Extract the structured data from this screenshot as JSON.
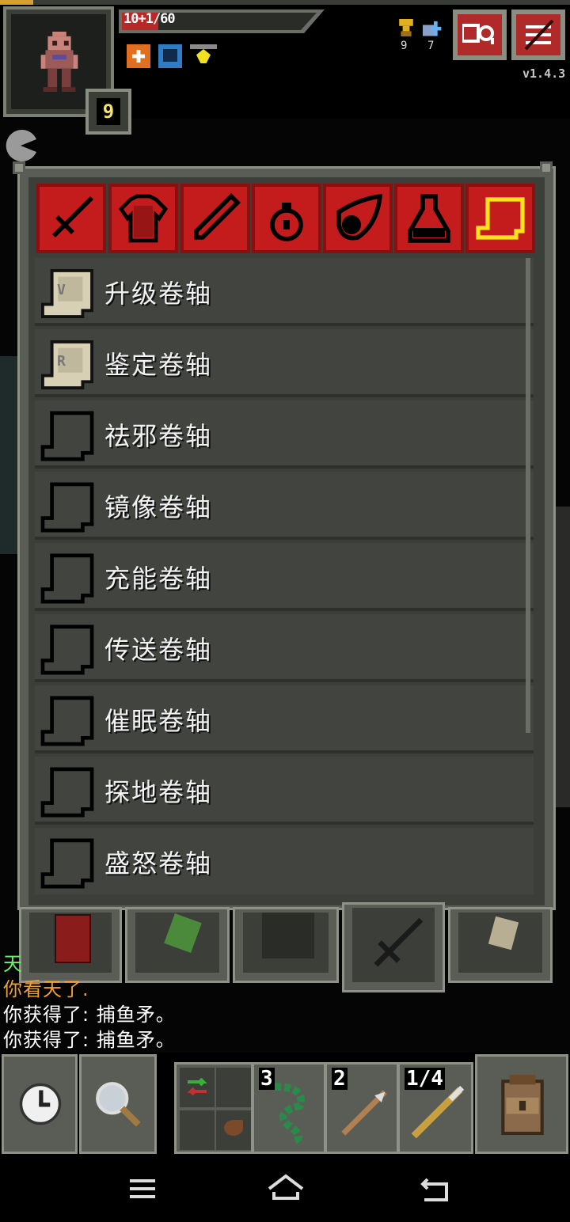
{
  "hud": {
    "hp_text": "10+1/60",
    "level": "9",
    "depth": "9",
    "keys": "7",
    "version": "v1.4.3",
    "buffs": [
      "mind-vision-icon",
      "shielded-icon",
      "light-icon"
    ]
  },
  "categories": [
    {
      "name": "weapon",
      "icon": "sword-icon"
    },
    {
      "name": "armor",
      "icon": "armor-icon"
    },
    {
      "name": "wand",
      "icon": "wand-icon"
    },
    {
      "name": "ring",
      "icon": "ring-icon"
    },
    {
      "name": "artifact",
      "icon": "artifact-icon"
    },
    {
      "name": "potion",
      "icon": "potion-icon"
    },
    {
      "name": "scroll",
      "icon": "scroll-icon",
      "active": true
    }
  ],
  "scrolls": [
    {
      "label": "升级卷轴",
      "known": true,
      "rune": "V"
    },
    {
      "label": "鉴定卷轴",
      "known": true,
      "rune": "R"
    },
    {
      "label": "祛邪卷轴",
      "known": false
    },
    {
      "label": "镜像卷轴",
      "known": false
    },
    {
      "label": "充能卷轴",
      "known": false
    },
    {
      "label": "传送卷轴",
      "known": false
    },
    {
      "label": "催眠卷轴",
      "known": false
    },
    {
      "label": "探地卷轴",
      "known": false
    },
    {
      "label": "盛怒卷轴",
      "known": false
    }
  ],
  "log": [
    {
      "text": "天",
      "color": "#6cf06c"
    },
    {
      "text": "你看天了.",
      "color": "#f0a030"
    },
    {
      "text": "你获得了: 捕鱼矛。",
      "color": "#ffffff"
    },
    {
      "text": "你获得了: 捕鱼矛。",
      "color": "#ffffff"
    }
  ],
  "quickslots": [
    {
      "count": "3",
      "item": "bolas-icon"
    },
    {
      "count": "2",
      "item": "dart-icon"
    },
    {
      "count": "1/4",
      "item": "fishing-spear-icon"
    }
  ],
  "colors": {
    "accent": "#c41c1c",
    "active_tab_outline": "#ffe21c",
    "panel": "#3c3e39"
  }
}
